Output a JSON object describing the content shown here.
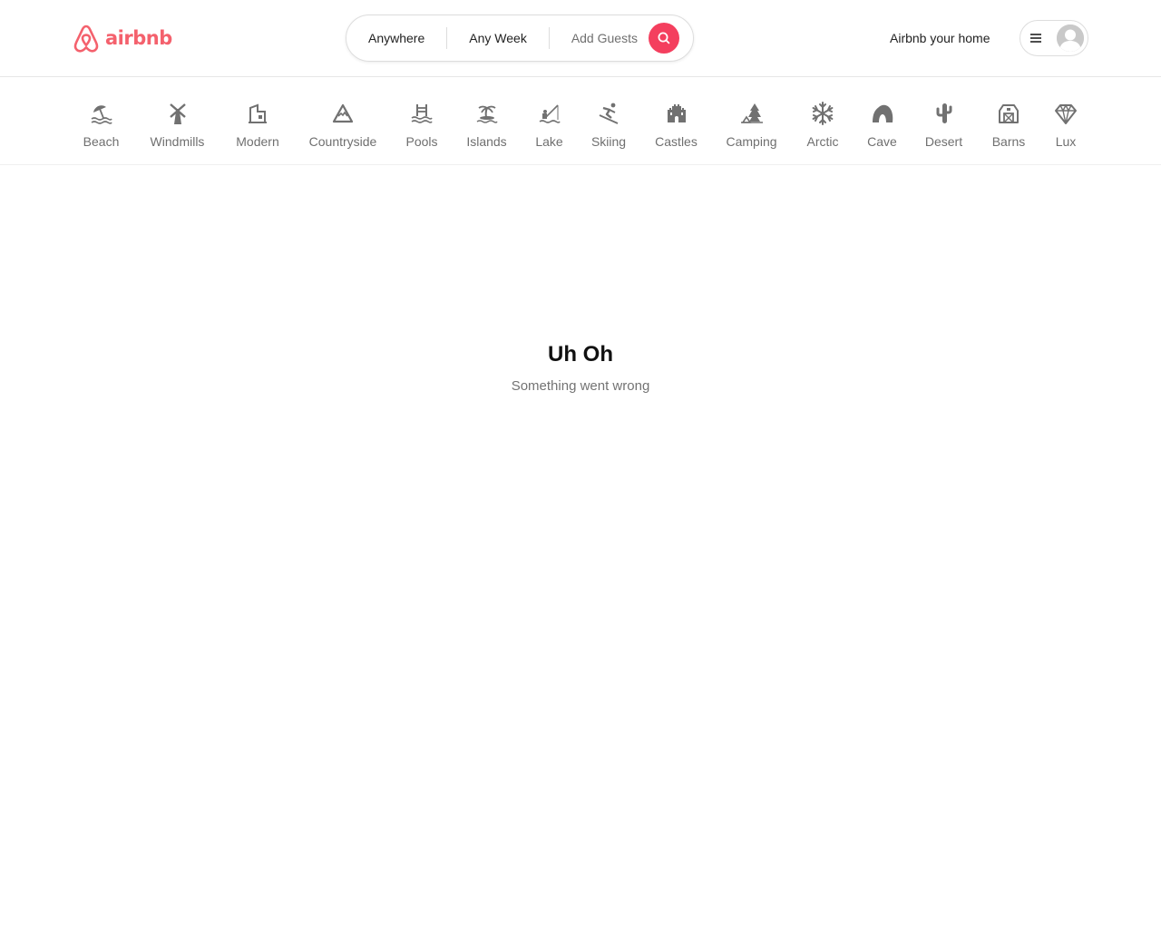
{
  "brand": {
    "name": "airbnb",
    "color": "#f4616d",
    "logo_icon": "airbnb-belo-icon"
  },
  "search": {
    "location": "Anywhere",
    "week": "Any Week",
    "guests": "Add Guests",
    "button_icon": "search-icon",
    "button_color": "#f43f5e"
  },
  "header": {
    "host_link": "Airbnb your home",
    "menu_icon": "hamburger-menu-icon",
    "avatar_icon": "user-avatar-icon"
  },
  "categories": [
    {
      "label": "Beach",
      "icon": "beach-umbrella-icon"
    },
    {
      "label": "Windmills",
      "icon": "windmill-icon"
    },
    {
      "label": "Modern",
      "icon": "modern-building-icon"
    },
    {
      "label": "Countryside",
      "icon": "mountain-icon"
    },
    {
      "label": "Pools",
      "icon": "pool-icon"
    },
    {
      "label": "Islands",
      "icon": "palm-island-icon"
    },
    {
      "label": "Lake",
      "icon": "fishing-lake-icon"
    },
    {
      "label": "Skiing",
      "icon": "skier-icon"
    },
    {
      "label": "Castles",
      "icon": "castle-icon"
    },
    {
      "label": "Camping",
      "icon": "tent-tree-icon"
    },
    {
      "label": "Arctic",
      "icon": "snowflake-icon"
    },
    {
      "label": "Cave",
      "icon": "cave-icon"
    },
    {
      "label": "Desert",
      "icon": "cactus-icon"
    },
    {
      "label": "Barns",
      "icon": "barn-icon"
    },
    {
      "label": "Lux",
      "icon": "diamond-icon"
    }
  ],
  "error": {
    "title": "Uh Oh",
    "subtitle": "Something went wrong"
  }
}
